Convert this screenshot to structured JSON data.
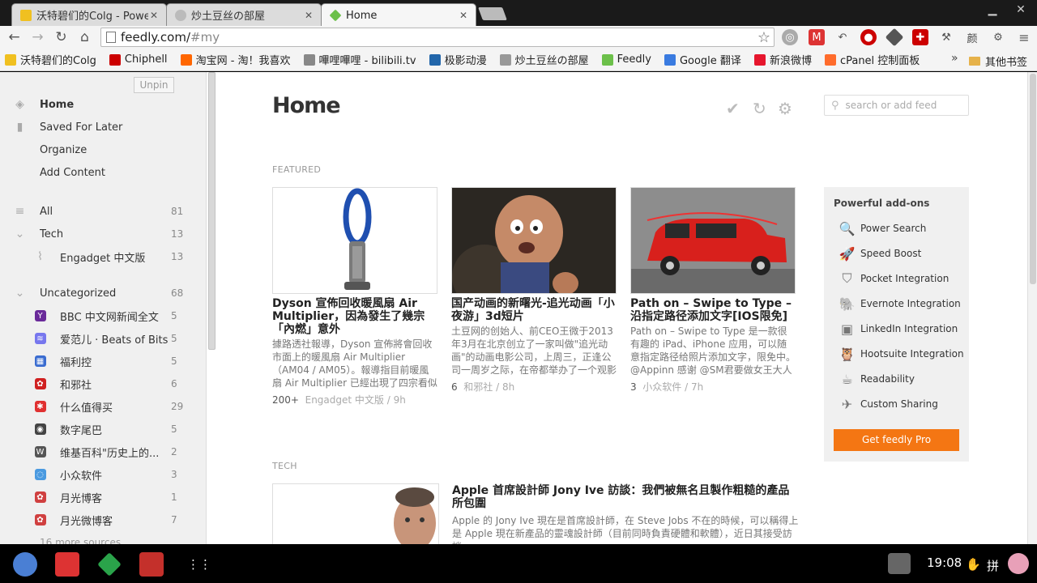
{
  "tabs": [
    {
      "title": "沃特碧们的Colg - Power"
    },
    {
      "title": "炒土豆丝の部屋"
    },
    {
      "title": "Home"
    }
  ],
  "window": {
    "minimize": "▁",
    "maximize": "☐",
    "close": "✕"
  },
  "address": {
    "host": "feedly.com/",
    "path": "#my"
  },
  "bookmarks": [
    {
      "label": "沃特碧们的Colg",
      "color": "#f0c020"
    },
    {
      "label": "Chiphell",
      "color": "#c00"
    },
    {
      "label": "淘宝网 - 淘！我喜欢",
      "color": "#f60"
    },
    {
      "label": "嗶哩嗶哩 - bilibili.tv",
      "color": "#888"
    },
    {
      "label": "极影动漫",
      "color": "#2266aa"
    },
    {
      "label": "炒土豆丝の部屋",
      "color": "#999"
    },
    {
      "label": "Feedly",
      "color": "#6cc04a"
    },
    {
      "label": "Google 翻译",
      "color": "#3a7be0"
    },
    {
      "label": "新浪微博",
      "color": "#e6162d"
    },
    {
      "label": "cPanel 控制面板",
      "color": "#ff6c2c"
    }
  ],
  "bookmarks_more": "»",
  "bookmarks_other": "其他书签",
  "sidebar": {
    "unpin": "Unpin",
    "nav": [
      {
        "label": "Home"
      },
      {
        "label": "Saved For Later"
      },
      {
        "label": "Organize"
      },
      {
        "label": "Add Content"
      }
    ],
    "all": {
      "label": "All",
      "count": "81"
    },
    "tech": {
      "label": "Tech",
      "count": "13"
    },
    "tech_feeds": [
      {
        "label": "Engadget 中文版",
        "count": "13"
      }
    ],
    "uncat": {
      "label": "Uncategorized",
      "count": "68"
    },
    "feeds": [
      {
        "label": "BBC 中文网新闻全文",
        "count": "5",
        "color": "#6a2a9a",
        "glyph": "Y"
      },
      {
        "label": "爱范儿 · Beats of Bits",
        "count": "5",
        "color": "#7777ee",
        "glyph": "≋"
      },
      {
        "label": "福利控",
        "count": "5",
        "color": "#3a6cd0",
        "glyph": "▦"
      },
      {
        "label": "和邪社",
        "count": "6",
        "color": "#d02020",
        "glyph": "✿"
      },
      {
        "label": "什么值得买",
        "count": "29",
        "color": "#e03030",
        "glyph": "✱"
      },
      {
        "label": "数字尾巴",
        "count": "5",
        "color": "#444",
        "glyph": "◉"
      },
      {
        "label": "维基百科\"历史上的...",
        "count": "2",
        "color": "#555",
        "glyph": "W"
      },
      {
        "label": "小众软件",
        "count": "3",
        "color": "#4a9ae0",
        "glyph": "◌"
      },
      {
        "label": "月光博客",
        "count": "1",
        "color": "#d04040",
        "glyph": "✿"
      },
      {
        "label": "月光微博客",
        "count": "7",
        "color": "#d04040",
        "glyph": "✿"
      }
    ],
    "more": "16 more sources"
  },
  "main": {
    "title": "Home",
    "search_placeholder": "search or add feed",
    "featured_label": "FEATURED",
    "tech_label": "TECH"
  },
  "cards": [
    {
      "title": "Dyson 宣佈回收暖風扇 Air Multiplier，因為發生了幾宗「內燃」意外",
      "summary": "據路透社報導，Dyson 宣佈將會回收市面上的暖風扇 Air Multiplier（AM04 / AM05）。報導指目前暖風扇 Air Multiplier 已經出現了四宗看似值得關",
      "count": "200+",
      "source": "Engadget 中文版 / 9h"
    },
    {
      "title": "国产动画的新曙光-追光动画「小夜游」3d短片",
      "summary": "土豆网的创始人、前CEO王微于2013年3月在北京创立了一家叫做\"追光动画\"的动画电影公司，上周三，正逢公司一周岁之际，在帝都举办了一个观影会，展示了这一年以来的成果。我当时",
      "count": "6",
      "source": "和邪社 / 8h"
    },
    {
      "title": "Path on – Swipe to Type – 沿指定路径添加文字[IOS限免]",
      "summary": "Path on – Swipe to Type 是一款很有趣的 iPad、iPhone 应用，可以随意指定路径给照片添加文字，限免中。@Appinn 感谢 @SM君要做女王大人 的第二次推荐，第一次推荐没赶上限免...",
      "count": "3",
      "source": "小众软件 / 7h"
    }
  ],
  "addons": {
    "title": "Powerful add-ons",
    "items": [
      {
        "label": "Power Search",
        "icon": "🔍"
      },
      {
        "label": "Speed Boost",
        "icon": "🚀"
      },
      {
        "label": "Pocket Integration",
        "icon": "⛉"
      },
      {
        "label": "Evernote Integration",
        "icon": "🐘"
      },
      {
        "label": "LinkedIn Integration",
        "icon": "▣"
      },
      {
        "label": "Hootsuite Integration",
        "icon": "🦉"
      },
      {
        "label": "Readability",
        "icon": "☕"
      },
      {
        "label": "Custom Sharing",
        "icon": "✈"
      }
    ],
    "cta": "Get feedly Pro"
  },
  "tech_article": {
    "title": "Apple 首席設計師 Jony Ive 訪談：我們被無名且製作粗糙的產品所包圍",
    "summary": "Apple 的 Jony Ive 現在是首席設計師，在 Steve Jobs 不在的時候，可以稱得上是 Apple 現在新產品的靈魂設計師（目前同時負責硬體和軟體），近日其接受訪談"
  },
  "tray": {
    "clock": "19:08",
    "ime": "拼"
  }
}
